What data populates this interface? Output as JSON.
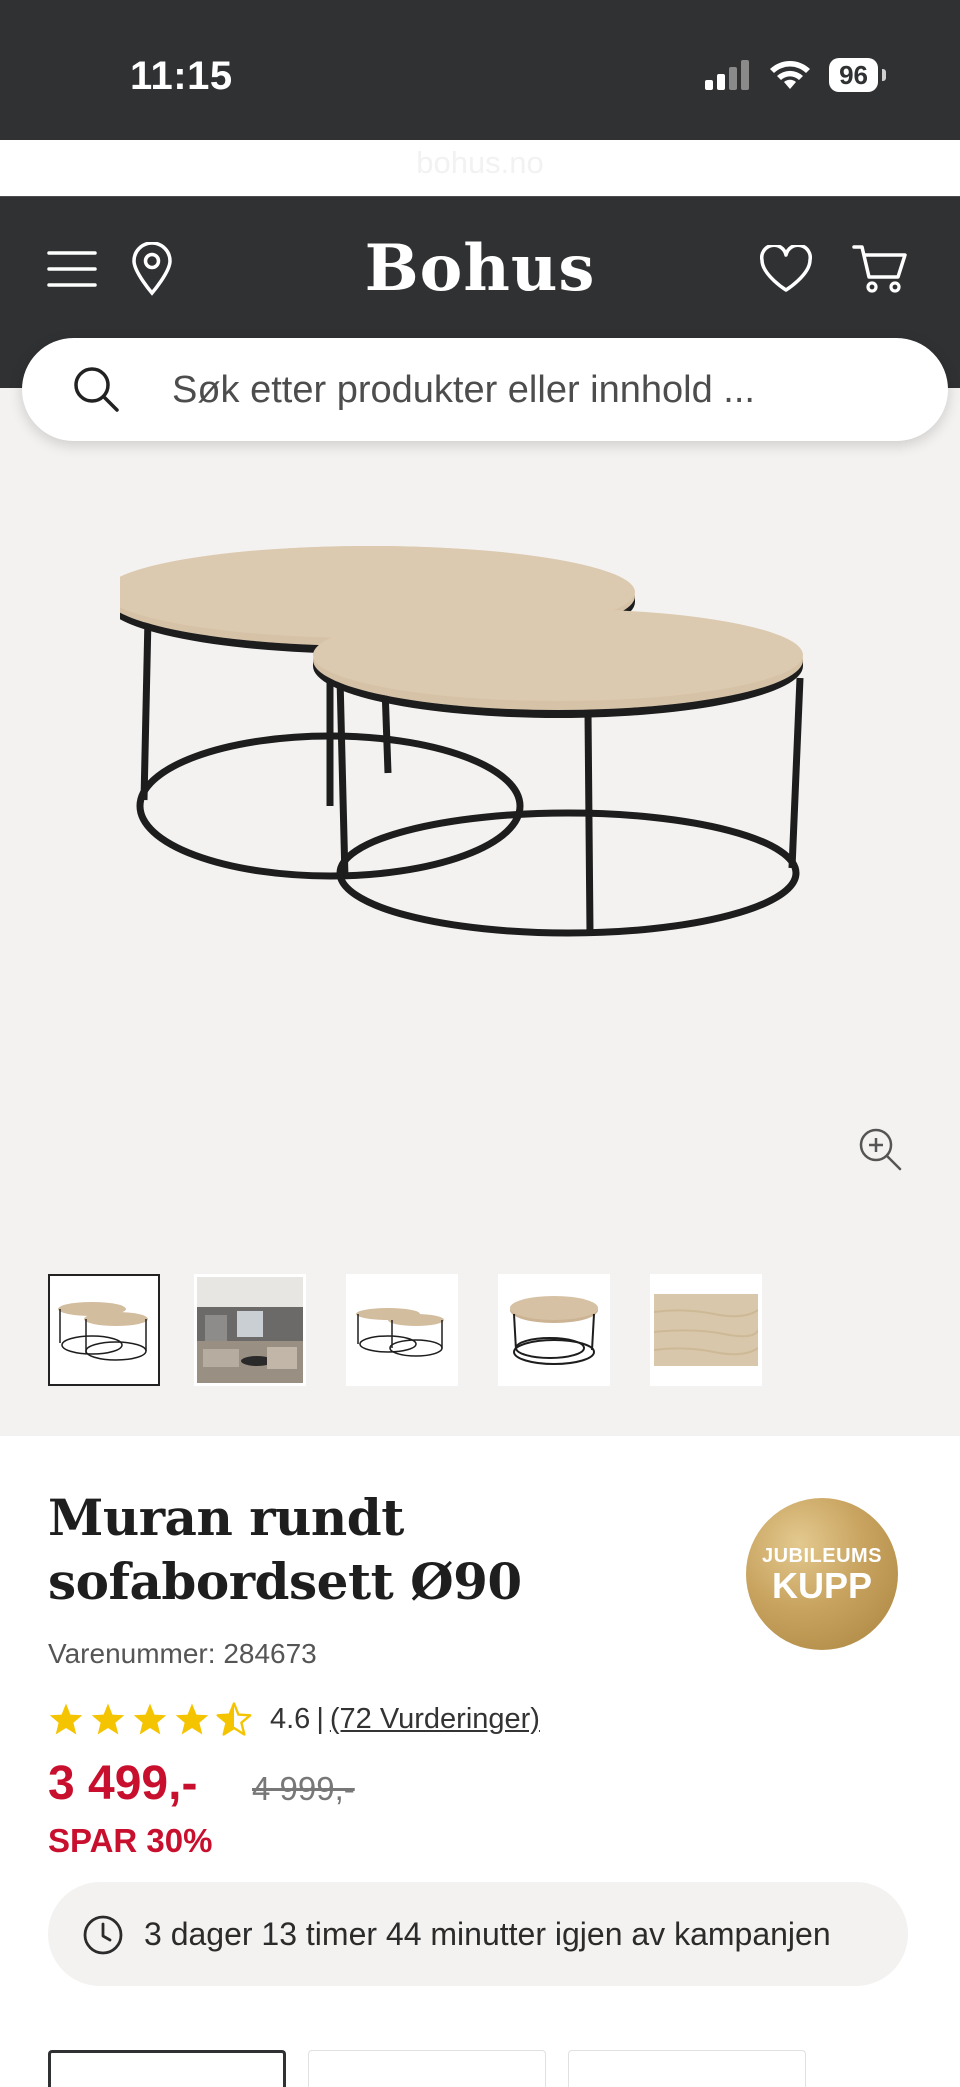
{
  "status_bar": {
    "time": "11:15",
    "battery": "96",
    "url": "bohus.no"
  },
  "header": {
    "logo": "Bohus",
    "icons": [
      "menu-icon",
      "location-pin-icon",
      "heart-icon",
      "cart-icon"
    ]
  },
  "search": {
    "placeholder": "Søk etter produkter eller innhold ..."
  },
  "gallery": {
    "thumbnails": [
      "product-front",
      "room-photo",
      "product-side",
      "product-top",
      "wood-sample"
    ],
    "active_thumbnail": 1
  },
  "product": {
    "title": "Muran rundt sofabordsett Ø90",
    "sku": "Varenummer: 284673",
    "badge": {
      "top": "JUBILEUMS",
      "bottom": "KUPP"
    },
    "rating": {
      "value": "4.6",
      "stars": 4.6,
      "separator": "|",
      "reviews": "(72 Vurderinger)"
    },
    "price": "3 499,-",
    "old_price": "4 999,-",
    "save": "SPAR 30%",
    "campaign": "3 dager 13 timer 44 minutter igjen av kampanjen"
  },
  "colors": {
    "header_bg": "#2f3133",
    "gallery_bg": "#f4f2f0",
    "price_red": "#c8102e",
    "star_yellow": "#f5c400",
    "badge_gold": "#c8a35f"
  }
}
